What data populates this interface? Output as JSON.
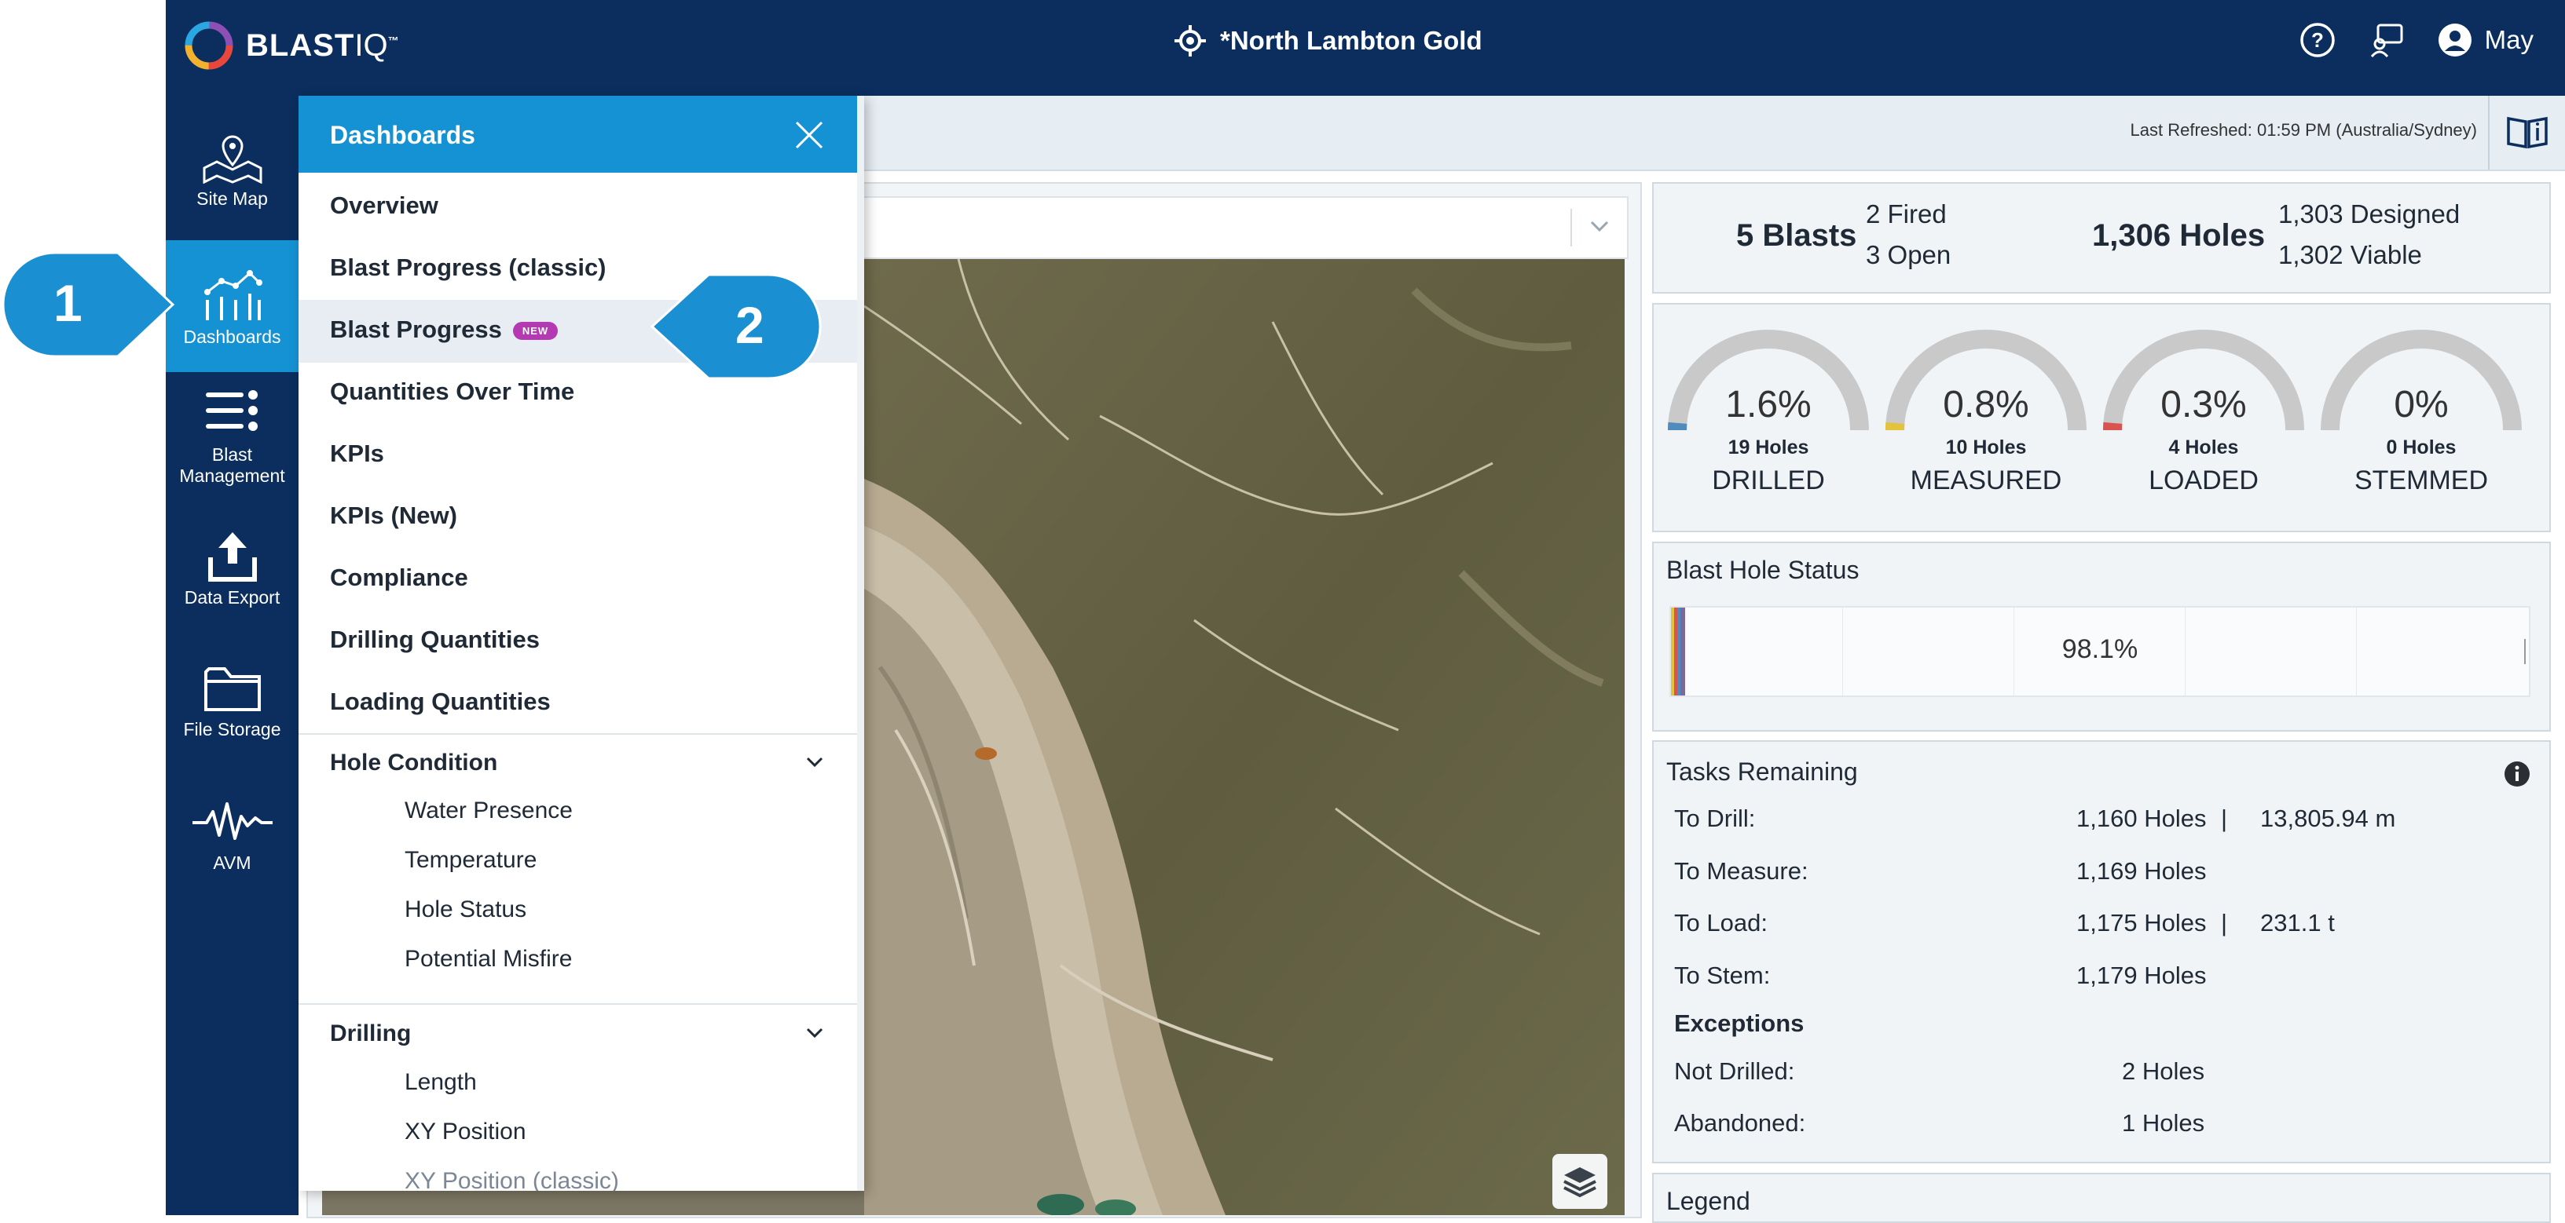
{
  "app": {
    "logo": "BLAST",
    "logo_suffix": "IQ",
    "logo_tm": "™"
  },
  "header": {
    "site_name": "*North Lambton Gold",
    "user_name": "May"
  },
  "nav": {
    "items": [
      {
        "label": "Site Map"
      },
      {
        "label": "Dashboards"
      },
      {
        "label": "Blast Management"
      },
      {
        "label": "Data Export"
      },
      {
        "label": "File Storage"
      },
      {
        "label": "AVM"
      }
    ]
  },
  "subheader": {
    "last_refreshed": "Last Refreshed: 01:59 PM (Australia/Sydney)"
  },
  "menu": {
    "title": "Dashboards",
    "items": [
      {
        "label": "Overview"
      },
      {
        "label": "Blast Progress (classic)"
      },
      {
        "label": "Blast Progress",
        "badge": "NEW"
      },
      {
        "label": "Quantities Over Time"
      },
      {
        "label": "KPIs"
      },
      {
        "label": "KPIs (New)"
      },
      {
        "label": "Compliance"
      },
      {
        "label": "Drilling Quantities"
      },
      {
        "label": "Loading Quantities"
      }
    ],
    "sections": [
      {
        "title": "Hole Condition",
        "items": [
          "Water Presence",
          "Temperature",
          "Hole Status",
          "Potential Misfire"
        ]
      },
      {
        "title": "Drilling",
        "items": [
          "Length",
          "XY Position",
          "XY Position (classic)"
        ]
      }
    ]
  },
  "callouts": {
    "one": "1",
    "two": "2"
  },
  "summary": {
    "blasts": "5 Blasts",
    "fired": "2 Fired",
    "open": "3 Open",
    "holes": "1,306 Holes",
    "designed": "1,303 Designed",
    "viable": "1,302 Viable"
  },
  "gauges": [
    {
      "pct": "1.6%",
      "value": 1.6,
      "holes": "19 Holes",
      "label": "DRILLED",
      "color": "#4f8bbf"
    },
    {
      "pct": "0.8%",
      "value": 0.8,
      "holes": "10 Holes",
      "label": "MEASURED",
      "color": "#e3c23c"
    },
    {
      "pct": "0.3%",
      "value": 0.3,
      "holes": "4 Holes",
      "label": "LOADED",
      "color": "#d9534f"
    },
    {
      "pct": "0%",
      "value": 0,
      "holes": "0 Holes",
      "label": "STEMMED",
      "color": "#8a8a8a"
    }
  ],
  "blast_hole_status": {
    "title": "Blast Hole Status",
    "value": "98.1%",
    "fraction": 0.981
  },
  "tasks": {
    "title": "Tasks Remaining",
    "to_drill": {
      "label": "To Drill:",
      "holes": "1,160 Holes",
      "sep": "|",
      "extra": "13,805.94 m"
    },
    "to_measure": {
      "label": "To Measure:",
      "holes": "1,169 Holes"
    },
    "to_load": {
      "label": "To Load:",
      "holes": "1,175 Holes",
      "sep": "|",
      "extra": "231.1 t"
    },
    "to_stem": {
      "label": "To Stem:",
      "holes": "1,179 Holes"
    },
    "exceptions": "Exceptions",
    "not_drilled": {
      "label": "Not Drilled:",
      "holes": "2 Holes"
    },
    "abandoned": {
      "label": "Abandoned:",
      "holes": "1 Holes"
    }
  },
  "legend": {
    "title": "Legend"
  },
  "colors": {
    "navy": "#0b2e5e",
    "accent": "#1592d4",
    "badge": "#b43ab4"
  }
}
